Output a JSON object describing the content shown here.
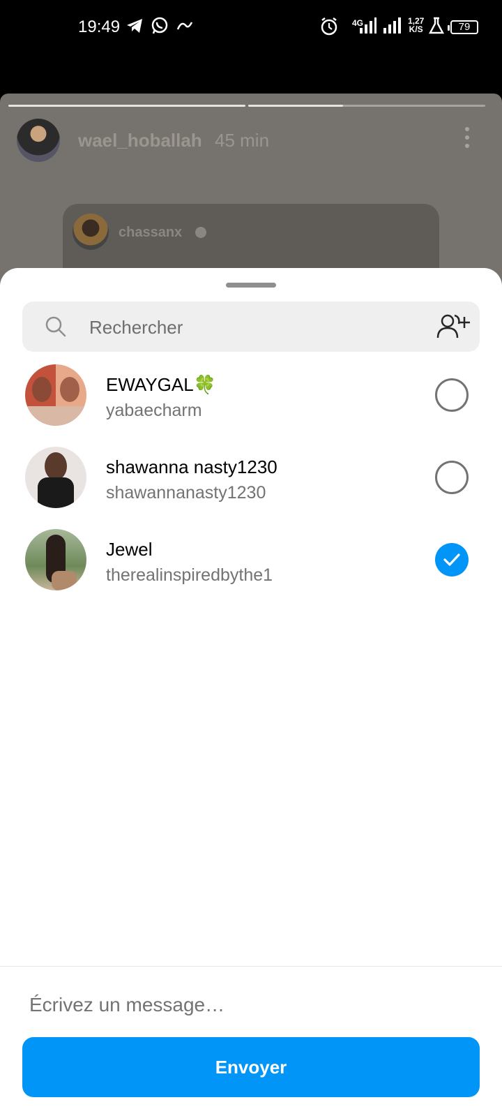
{
  "status_bar": {
    "time": "19:49",
    "network": "4G",
    "net_speed_top": "1,27",
    "net_speed_bottom": "K/S",
    "battery": "79",
    "icons": [
      "telegram-icon",
      "whatsapp-icon",
      "app-notification-icon",
      "alarm-icon",
      "signal-icon",
      "signal-icon",
      "lab-icon",
      "battery-icon"
    ]
  },
  "story": {
    "username": "wael_hoballah",
    "time_ago": "45 min",
    "progress": [
      1.0,
      0.4
    ],
    "embedded_post": {
      "username": "chassanx"
    }
  },
  "share_sheet": {
    "search": {
      "placeholder": "Rechercher"
    },
    "contacts": [
      {
        "name": "EWAYGAL🍀",
        "username": "yabaecharm",
        "selected": false
      },
      {
        "name": "shawanna nasty1230",
        "username": "shawannanasty1230",
        "selected": false
      },
      {
        "name": "Jewel",
        "username": "therealinspiredbythe1",
        "selected": true
      }
    ],
    "message": {
      "placeholder": "Écrivez un message…"
    },
    "send_label": "Envoyer"
  },
  "colors": {
    "accent": "#0095f6",
    "sheet_bg": "#ffffff",
    "backdrop": "#76736e"
  }
}
